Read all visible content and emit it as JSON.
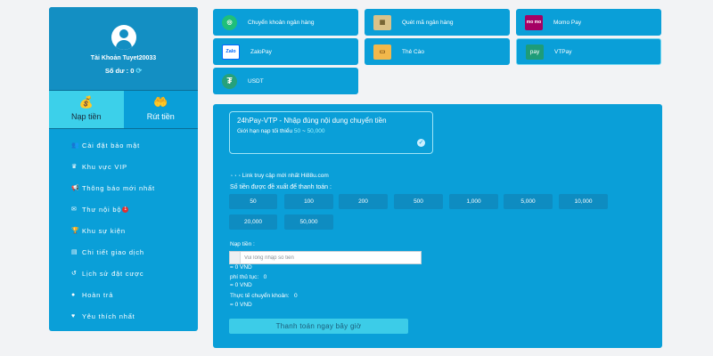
{
  "sidebar": {
    "username": "Tài Khoản Tuyet20033",
    "balance_label": "Số dư :",
    "balance_value": "0",
    "tabs": [
      {
        "label": "Nạp tiền",
        "icon": "deposit-icon"
      },
      {
        "label": "Rút tiền",
        "icon": "withdraw-icon"
      }
    ],
    "menu": [
      {
        "label": "Cài đặt bảo mật",
        "icon": "users-icon"
      },
      {
        "label": "Khu vực VIP",
        "icon": "crown-icon"
      },
      {
        "label": "Thông báo mới nhất",
        "icon": "megaphone-icon"
      },
      {
        "label": "Thư nội bộ",
        "icon": "envelope-icon",
        "badge": "1"
      },
      {
        "label": "Khu sự kiện",
        "icon": "trophy-icon"
      },
      {
        "label": "Chi tiết giao dịch",
        "icon": "receipt-icon"
      },
      {
        "label": "Lịch sử đặt cược",
        "icon": "history-icon"
      },
      {
        "label": "Hoàn trả",
        "icon": "refund-icon"
      },
      {
        "label": "Yêu thích nhất",
        "icon": "heart-icon"
      }
    ]
  },
  "payment_methods": [
    {
      "label": "Chuyển khoản ngân hàng",
      "icon": "globe-icon"
    },
    {
      "label": "Quét mã ngân hàng",
      "icon": "qr-code-icon"
    },
    {
      "label": "Momo Pay",
      "icon": "momo-icon",
      "icon_text": "mo mo"
    },
    {
      "label": "ZaloPay",
      "icon": "zalopay-icon",
      "icon_text": "Zalo"
    },
    {
      "label": "Thẻ Cào",
      "icon": "scratch-card-icon"
    },
    {
      "label": "VTPay",
      "icon": "viettelpay-icon",
      "icon_text": "pay"
    },
    {
      "label": "USDT",
      "icon": "usdt-icon",
      "icon_text": "₮"
    }
  ],
  "selected_method": "VTPay",
  "channel": {
    "name": "24hPay-VTP - Nhập đúng nội dung chuyển tiền",
    "limit_label": "Giới hạn nạp tối thiểu",
    "limit_min": "50",
    "limit_sep": "~",
    "limit_max": "50,000"
  },
  "link_text": "Link truy cập mới nhất Hi88u.com",
  "suggested_title": "Số tiền được đề xuất để thanh toán :",
  "amounts": [
    "50",
    "100",
    "200",
    "500",
    "1,000",
    "5,000",
    "10,000",
    "20,000",
    "50,000"
  ],
  "deposit": {
    "label": "Nạp tiền :",
    "placeholder": "Vui lòng nhập số tiền",
    "value_line": "= 0 VND",
    "fee_label": "phí thủ tục:",
    "fee_value": "0",
    "fee_vnd": "= 0 VND",
    "actual_label": "Thực tế chuyển khoản:",
    "actual_value": "0",
    "actual_vnd": "= 0 VND"
  },
  "pay_button": "Thanh toán ngay bây giờ",
  "colors": {
    "accent": "#0a9fd8",
    "active_tab": "#3cd0ea",
    "button": "#3ccce8",
    "highlight": "#9ff4ff"
  }
}
